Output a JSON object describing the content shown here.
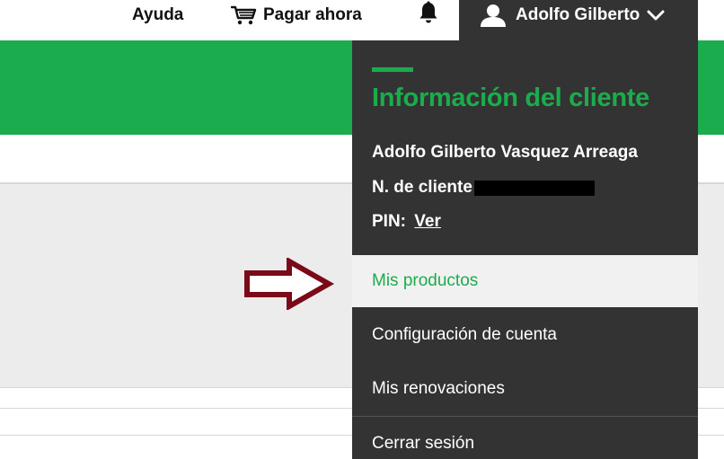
{
  "nav": {
    "help_label": "Ayuda",
    "pay_label": "Pagar ahora",
    "user_name": "Adolfo Gilberto"
  },
  "icons": {
    "cart": "cart-icon",
    "bell": "bell-icon",
    "user": "user-icon",
    "chevron": "chevron-down-icon",
    "arrow": "right-arrow-annotation"
  },
  "dropdown": {
    "title": "Información del cliente",
    "full_name": "Adolfo Gilberto Vasquez Arreaga",
    "client_number_label": "N. de cliente",
    "pin_label": "PIN:",
    "pin_link": "Ver",
    "items": [
      {
        "label": "Mis productos",
        "active": true
      },
      {
        "label": "Configuración de cuenta",
        "active": false
      },
      {
        "label": "Mis renovaciones",
        "active": false
      },
      {
        "label": "Cerrar sesión",
        "active": false
      }
    ]
  },
  "colors": {
    "brand_green": "#1bad4d",
    "dropdown_bg": "#333333",
    "arrow_color": "#7a0a17",
    "active_item_bg": "#f1f1f1"
  }
}
